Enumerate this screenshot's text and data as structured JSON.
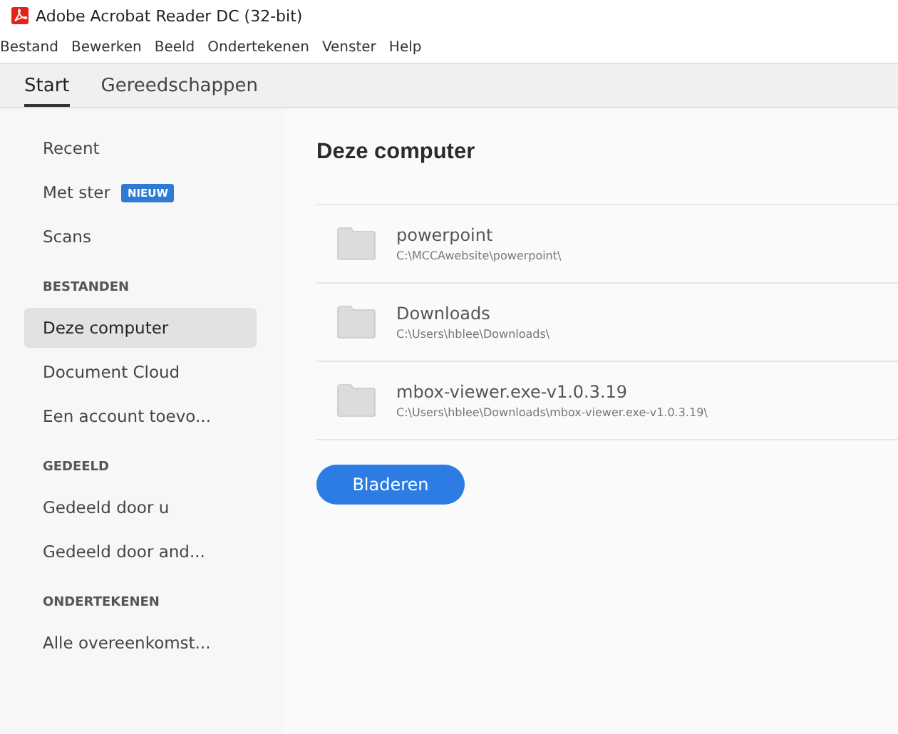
{
  "window": {
    "title": "Adobe Acrobat Reader DC (32-bit)"
  },
  "menu": [
    "Bestand",
    "Bewerken",
    "Beeld",
    "Ondertekenen",
    "Venster",
    "Help"
  ],
  "tabs": [
    {
      "label": "Start",
      "selected": true
    },
    {
      "label": "Gereedschappen",
      "selected": false
    }
  ],
  "sidebar": {
    "items": [
      {
        "kind": "item",
        "label": "Recent",
        "selected": false
      },
      {
        "kind": "item",
        "label": "Met ster",
        "badge": "NIEUW",
        "selected": false
      },
      {
        "kind": "item",
        "label": "Scans",
        "selected": false
      },
      {
        "kind": "header",
        "label": "BESTANDEN"
      },
      {
        "kind": "item",
        "label": "Deze computer",
        "selected": true
      },
      {
        "kind": "item",
        "label": "Document Cloud",
        "selected": false
      },
      {
        "kind": "item",
        "label": "Een account toevo...",
        "selected": false
      },
      {
        "kind": "header",
        "label": "GEDEELD"
      },
      {
        "kind": "item",
        "label": "Gedeeld door u",
        "selected": false
      },
      {
        "kind": "item",
        "label": "Gedeeld door and...",
        "selected": false
      },
      {
        "kind": "header",
        "label": "ONDERTEKENEN"
      },
      {
        "kind": "item",
        "label": "Alle overeenkomst...",
        "selected": false
      }
    ]
  },
  "content": {
    "heading": "Deze computer",
    "folders": [
      {
        "name": "powerpoint",
        "path": "C:\\MCCAwebsite\\powerpoint\\"
      },
      {
        "name": "Downloads",
        "path": "C:\\Users\\hblee\\Downloads\\"
      },
      {
        "name": "mbox-viewer.exe-v1.0.3.19",
        "path": "C:\\Users\\hblee\\Downloads\\mbox-viewer.exe-v1.0.3.19\\"
      }
    ],
    "button": "Bladeren"
  }
}
